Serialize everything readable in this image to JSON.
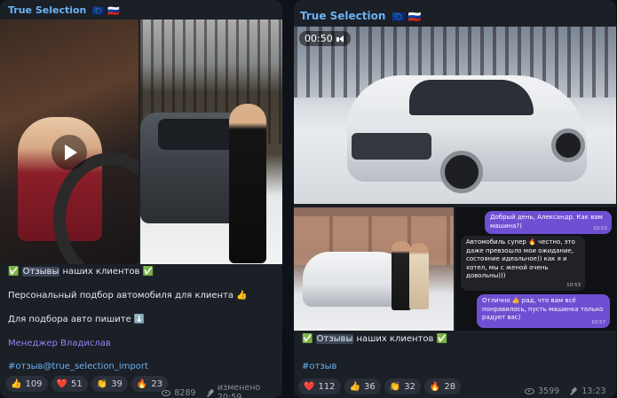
{
  "post1": {
    "channel": "True Selection",
    "flags": [
      "🇪🇺",
      "🇷🇺"
    ],
    "caption": {
      "line1_prefix": "✅",
      "line1_highlight": "Отзывы",
      "line1_rest": " наших клиентов ",
      "line1_suffix": "✅",
      "line2": "Персональный подбор автомобиля для клиента 👍",
      "line3": "Для подбора авто пишите ⬇️",
      "manager": "Менеджер Владислав",
      "hashtag": "#отзыв@true_selection_import"
    },
    "reactions": [
      {
        "emoji": "👍",
        "count": "109"
      },
      {
        "emoji": "❤️",
        "count": "51"
      },
      {
        "emoji": "👏",
        "count": "39"
      },
      {
        "emoji": "🔥",
        "count": "23"
      }
    ],
    "views": "8289",
    "edited_time": "изменено 20:59"
  },
  "post2": {
    "channel": "True Selection",
    "flags": [
      "🇪🇺",
      "🇷🇺"
    ],
    "video_duration": "00:50",
    "chat_screenshot": {
      "msg1": "Добрый день, Александр. Как вам машина?)",
      "msg1_time": "10:52",
      "msg2": "Автомобиль супер 🔥 честно, это даже превзошло мои ожидание, состояние идеальное)) как я и хотел, мы с женой очень довольны)))",
      "msg2_time": "10:53",
      "msg3": "Отлично 👍 рад, что вам всё понравилось, пусть машинка только радует вас)",
      "msg3_time": "10:57"
    },
    "caption": {
      "line1_prefix": "✅",
      "line1_highlight": "Отзывы",
      "line1_rest": " наших клиентов ",
      "line1_suffix": "✅",
      "hashtag": "#отзыв"
    },
    "reactions": [
      {
        "emoji": "❤️",
        "count": "112"
      },
      {
        "emoji": "👍",
        "count": "36"
      },
      {
        "emoji": "👏",
        "count": "32"
      },
      {
        "emoji": "🔥",
        "count": "28"
      }
    ],
    "views": "3599",
    "time": "13:23"
  },
  "colors": {
    "bubble_bg": "#1b1f26",
    "channel_name": "#6ab3f3",
    "link": "#8f86f5",
    "check": "#5fc04a"
  }
}
